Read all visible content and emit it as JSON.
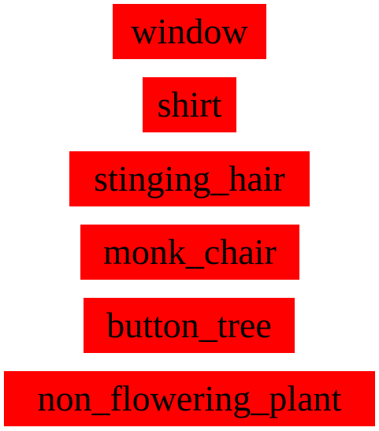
{
  "labels": [
    "window",
    "shirt",
    "stinging_hair",
    "monk_chair",
    "button_tree",
    "non_flowering_plant"
  ],
  "colors": {
    "box_background": "#ff0000",
    "text": "#000000",
    "page_background": "#ffffff"
  }
}
